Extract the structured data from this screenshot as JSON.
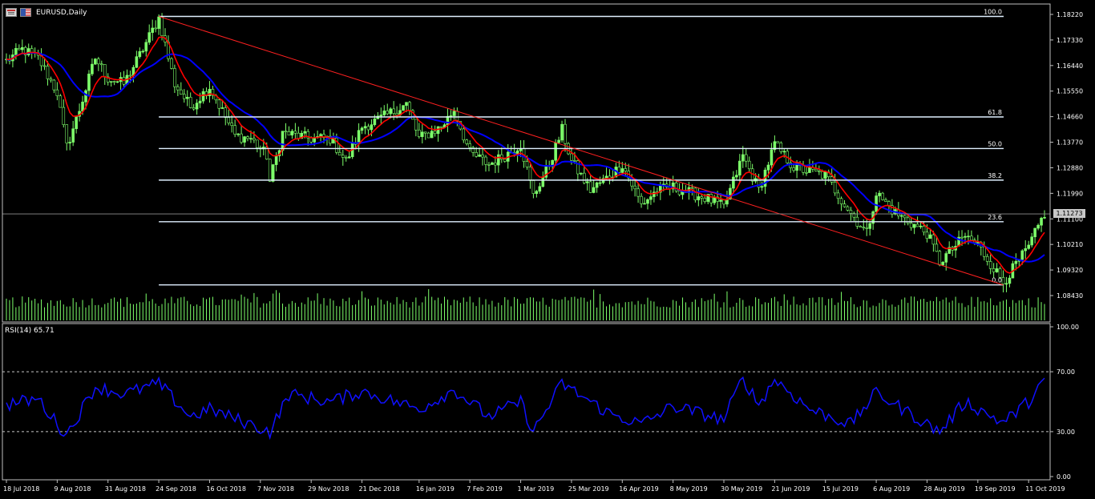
{
  "header": {
    "symbol_title": "EURUSD,Daily",
    "rsi_title": "RSI(14) 65.71",
    "window_icon": "chart-window-icon",
    "flag_icon": "eu-us-flag-icon"
  },
  "current_price": "1.11273",
  "colors": {
    "background": "#000000",
    "axis": "#c0c0c0",
    "bull_candle": "#7dff6a",
    "bear_candle": "#7dff6a",
    "fib_level": "#e0f0ff",
    "trend_line": "#ff2020",
    "ma_fast": "#ff0000",
    "ma_slow": "#0000ff",
    "rsi_line": "#1010ff",
    "volume": "#7dff6a"
  },
  "chart_data": [
    {
      "type": "candlestick",
      "symbol": "EURUSD",
      "timeframe": "Daily",
      "ylim": [
        1.08,
        1.185
      ],
      "y_ticks": [
        "1.18220",
        "1.17330",
        "1.16440",
        "1.15550",
        "1.14660",
        "1.13770",
        "1.12880",
        "1.11990",
        "1.11100",
        "1.10210",
        "1.09320",
        "1.08430"
      ],
      "x_ticks": [
        "18 Jul 2018",
        "9 Aug 2018",
        "31 Aug 2018",
        "24 Sep 2018",
        "16 Oct 2018",
        "7 Nov 2018",
        "29 Nov 2018",
        "21 Dec 2018",
        "16 Jan 2019",
        "7 Feb 2019",
        "1 Mar 2019",
        "25 Mar 2019",
        "16 Apr 2019",
        "8 May 2019",
        "30 May 2019",
        "21 Jun 2019",
        "15 Jul 2019",
        "6 Aug 2019",
        "28 Aug 2019",
        "19 Sep 2019",
        "11 Oct 2019"
      ],
      "close_anchors": [
        [
          "18 Jul 2018",
          1.166
        ],
        [
          "25 Jul 2018",
          1.17
        ],
        [
          "1 Aug 2018",
          1.167
        ],
        [
          "9 Aug 2018",
          1.155
        ],
        [
          "14 Aug 2018",
          1.136
        ],
        [
          "20 Aug 2018",
          1.149
        ],
        [
          "27 Aug 2018",
          1.167
        ],
        [
          "31 Aug 2018",
          1.16
        ],
        [
          "7 Sep 2018",
          1.158
        ],
        [
          "14 Sep 2018",
          1.168
        ],
        [
          "24 Sep 2018",
          1.181
        ],
        [
          "1 Oct 2018",
          1.158
        ],
        [
          "8 Oct 2018",
          1.15
        ],
        [
          "16 Oct 2018",
          1.157
        ],
        [
          "26 Oct 2018",
          1.14
        ],
        [
          "2 Nov 2018",
          1.139
        ],
        [
          "9 Nov 2018",
          1.133
        ],
        [
          "12 Nov 2018",
          1.124
        ],
        [
          "16 Nov 2018",
          1.141
        ],
        [
          "29 Nov 2018",
          1.139
        ],
        [
          "7 Dec 2018",
          1.139
        ],
        [
          "14 Dec 2018",
          1.131
        ],
        [
          "21 Dec 2018",
          1.143
        ],
        [
          "31 Dec 2018",
          1.146
        ],
        [
          "10 Jan 2019",
          1.151
        ],
        [
          "16 Jan 2019",
          1.139
        ],
        [
          "25 Jan 2019",
          1.143
        ],
        [
          "31 Jan 2019",
          1.149
        ],
        [
          "7 Feb 2019",
          1.134
        ],
        [
          "15 Feb 2019",
          1.13
        ],
        [
          "22 Feb 2019",
          1.133
        ],
        [
          "1 Mar 2019",
          1.137
        ],
        [
          "7 Mar 2019",
          1.119
        ],
        [
          "14 Mar 2019",
          1.13
        ],
        [
          "20 Mar 2019",
          1.142
        ],
        [
          "25 Mar 2019",
          1.131
        ],
        [
          "2 Apr 2019",
          1.121
        ],
        [
          "10 Apr 2019",
          1.126
        ],
        [
          "16 Apr 2019",
          1.13
        ],
        [
          "24 Apr 2019",
          1.116
        ],
        [
          "1 May 2019",
          1.121
        ],
        [
          "8 May 2019",
          1.122
        ],
        [
          "23 May 2019",
          1.118
        ],
        [
          "30 May 2019",
          1.115
        ],
        [
          "7 Jun 2019",
          1.133
        ],
        [
          "14 Jun 2019",
          1.121
        ],
        [
          "21 Jun 2019",
          1.137
        ],
        [
          "1 Jul 2019",
          1.129
        ],
        [
          "15 Jul 2019",
          1.126
        ],
        [
          "25 Jul 2019",
          1.113
        ],
        [
          "1 Aug 2019",
          1.106
        ],
        [
          "6 Aug 2019",
          1.12
        ],
        [
          "14 Aug 2019",
          1.113
        ],
        [
          "28 Aug 2019",
          1.106
        ],
        [
          "3 Sep 2019",
          1.096
        ],
        [
          "13 Sep 2019",
          1.105
        ],
        [
          "19 Sep 2019",
          1.102
        ],
        [
          "1 Oct 2019",
          1.089
        ],
        [
          "11 Oct 2019",
          1.101
        ],
        [
          "18 Oct 2019",
          1.113
        ]
      ],
      "fibonacci": {
        "levels": [
          {
            "label": "100.0",
            "price": 1.1815
          },
          {
            "label": "61.8",
            "price": 1.1465
          },
          {
            "label": "50.0",
            "price": 1.1355
          },
          {
            "label": "38.2",
            "price": 1.1245
          },
          {
            "label": "23.6",
            "price": 1.11
          },
          {
            "label": "0.0",
            "price": 1.088
          }
        ]
      },
      "trend_line": {
        "from": [
          "24 Sep 2018",
          1.1815
        ],
        "to": [
          "1 Oct 2019",
          1.088
        ]
      },
      "moving_averages": [
        {
          "color": "red",
          "period_hint": "fast"
        },
        {
          "color": "blue",
          "period_hint": "slow"
        }
      ],
      "volume": true
    },
    {
      "type": "line",
      "title": "RSI(14) 65.71",
      "ylim": [
        0,
        100
      ],
      "y_ticks": [
        "100.00",
        "70.00",
        "30.00",
        "0.00"
      ],
      "levels": [
        70,
        30
      ],
      "last_value": 65.71,
      "anchors": [
        [
          "18 Jul 2018",
          48
        ],
        [
          "1 Aug 2018",
          52
        ],
        [
          "9 Aug 2018",
          35
        ],
        [
          "14 Aug 2018",
          28
        ],
        [
          "27 Aug 2018",
          60
        ],
        [
          "7 Sep 2018",
          55
        ],
        [
          "24 Sep 2018",
          62
        ],
        [
          "8 Oct 2018",
          40
        ],
        [
          "16 Oct 2018",
          45
        ],
        [
          "12 Nov 2018",
          30
        ],
        [
          "20 Nov 2018",
          55
        ],
        [
          "7 Dec 2018",
          50
        ],
        [
          "21 Dec 2018",
          57
        ],
        [
          "16 Jan 2019",
          45
        ],
        [
          "31 Jan 2019",
          58
        ],
        [
          "15 Feb 2019",
          40
        ],
        [
          "1 Mar 2019",
          50
        ],
        [
          "7 Mar 2019",
          30
        ],
        [
          "20 Mar 2019",
          62
        ],
        [
          "10 Apr 2019",
          42
        ],
        [
          "24 Apr 2019",
          35
        ],
        [
          "8 May 2019",
          47
        ],
        [
          "30 May 2019",
          38
        ],
        [
          "7 Jun 2019",
          66
        ],
        [
          "14 Jun 2019",
          48
        ],
        [
          "21 Jun 2019",
          65
        ],
        [
          "8 Jul 2019",
          45
        ],
        [
          "25 Jul 2019",
          35
        ],
        [
          "6 Aug 2019",
          56
        ],
        [
          "28 Aug 2019",
          35
        ],
        [
          "3 Sep 2019",
          30
        ],
        [
          "13 Sep 2019",
          50
        ],
        [
          "1 Oct 2019",
          36
        ],
        [
          "11 Oct 2019",
          50
        ],
        [
          "18 Oct 2019",
          65.71
        ]
      ]
    }
  ]
}
